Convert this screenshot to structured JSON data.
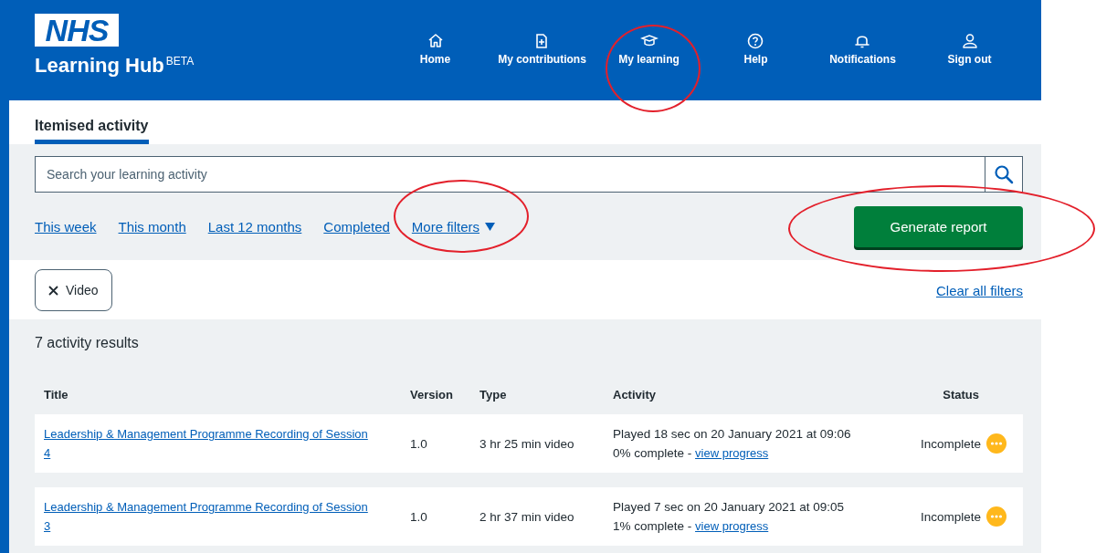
{
  "header": {
    "logo": "NHS",
    "title": "Learning Hub",
    "badge": "BETA",
    "nav": [
      {
        "label": "Home",
        "circled": false
      },
      {
        "label": "My contributions",
        "circled": false
      },
      {
        "label": "My learning",
        "circled": true
      },
      {
        "label": "Help",
        "circled": false
      },
      {
        "label": "Notifications",
        "circled": false
      },
      {
        "label": "Sign out",
        "circled": false
      }
    ]
  },
  "tabs": [
    {
      "label": "Itemised activity",
      "selected": true
    }
  ],
  "search": {
    "placeholder": "Search your learning activity"
  },
  "filter_links": [
    {
      "label": "This week",
      "kind": "link",
      "circled": false
    },
    {
      "label": "This month",
      "kind": "link",
      "circled": false
    },
    {
      "label": "Last 12 months",
      "kind": "link",
      "circled": false
    },
    {
      "label": "Completed",
      "kind": "link",
      "circled": false
    },
    {
      "label": "More filters",
      "kind": "dropdown",
      "circled": true
    }
  ],
  "generate_button": {
    "label": "Generate report",
    "circled": true
  },
  "active_filters": [
    {
      "label": "Video"
    }
  ],
  "clear_all": "Clear all filters",
  "results_count": "7 activity results",
  "table": {
    "columns": [
      "Title",
      "Version",
      "Type",
      "Activity",
      "Status"
    ],
    "rows": [
      {
        "title": "Leadership & Management Programme Recording of Session 4",
        "version": "1.0",
        "type": "3 hr 25 min video",
        "activity": "Played 18 sec on 20 January 2021 at 09:06",
        "progress": "0% complete - ",
        "progress_link": "view progress",
        "status": "Incomplete"
      },
      {
        "title": "Leadership & Management Programme Recording of Session 3",
        "version": "1.0",
        "type": "2 hr 37 min video",
        "activity": "Played 7 sec on 20 January 2021 at 09:05",
        "progress": "1% complete - ",
        "progress_link": "view progress",
        "status": "Incomplete"
      }
    ]
  }
}
